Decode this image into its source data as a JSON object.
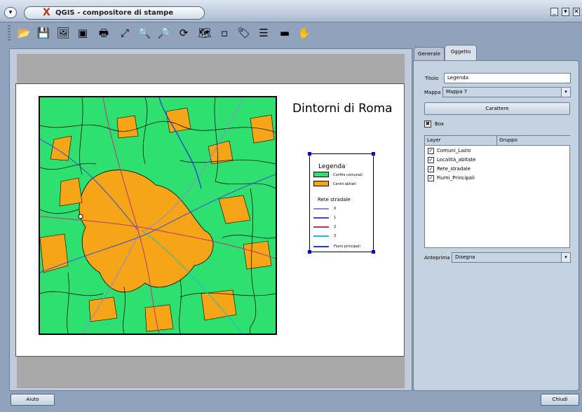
{
  "window": {
    "title": "QGIS - compositore di stampe",
    "logo": "X",
    "menu_glyph": "▾",
    "controls": [
      "_",
      "▾",
      "✕"
    ]
  },
  "toolbar": {
    "icons": [
      {
        "name": "open-template-icon",
        "glyph": "📂"
      },
      {
        "name": "save-template-icon",
        "glyph": "💾"
      },
      {
        "name": "export-image-icon",
        "glyph": "🖼"
      },
      {
        "name": "export-svg-icon",
        "glyph": "▣"
      },
      {
        "name": "print-icon",
        "glyph": "🖶"
      },
      {
        "name": "zoom-full-icon",
        "glyph": "⤢"
      },
      {
        "name": "zoom-in-icon",
        "glyph": "🔍"
      },
      {
        "name": "zoom-out-icon",
        "glyph": "🔎"
      },
      {
        "name": "refresh-icon",
        "glyph": "⟳"
      },
      {
        "name": "add-map-icon",
        "glyph": "🗺"
      },
      {
        "name": "add-image-icon",
        "glyph": "▫"
      },
      {
        "name": "add-label-icon",
        "glyph": "🏷"
      },
      {
        "name": "add-legend-icon",
        "glyph": "☰"
      },
      {
        "name": "add-scalebar-icon",
        "glyph": "▬"
      },
      {
        "name": "select-move-icon",
        "glyph": "✋"
      }
    ]
  },
  "composer": {
    "map_title": "Dintorni di Roma",
    "legend": {
      "title": "Legenda",
      "items": [
        {
          "label": "Confini comunali",
          "color": "#2fe070"
        },
        {
          "label": "Centri abitati",
          "color": "#f5a515"
        }
      ],
      "roads_title": "Rete stradale",
      "roads": [
        {
          "label": "0",
          "color": "#8a8ad8"
        },
        {
          "label": "1",
          "color": "#3b4bd8"
        },
        {
          "label": "2",
          "color": "#c0307a"
        },
        {
          "label": "3",
          "color": "#20b8c8"
        }
      ],
      "rivers": {
        "label": "Fiumi principali",
        "color": "#1a40d8"
      }
    }
  },
  "panel": {
    "tabs": [
      "Generale",
      "Oggetto"
    ],
    "active_tab": "Oggetto",
    "titolo_label": "Titolo",
    "titolo_value": "Legenda",
    "mappa_label": "Mappa",
    "mappa_value": "Mappa 7",
    "carattere_button": "Carattere",
    "box_label": "Box",
    "box_checked": true,
    "layers_header": [
      "Layer",
      "Gruppo"
    ],
    "layers": [
      "Comuni_Lazio",
      "Località_abitate",
      "Rete_stradale",
      "Fiumi_Principali"
    ],
    "anteprima_label": "Anteprima",
    "anteprima_value": "Disegna"
  },
  "footer": {
    "help_button": "Aiuto",
    "close_button": "Chiudi"
  }
}
